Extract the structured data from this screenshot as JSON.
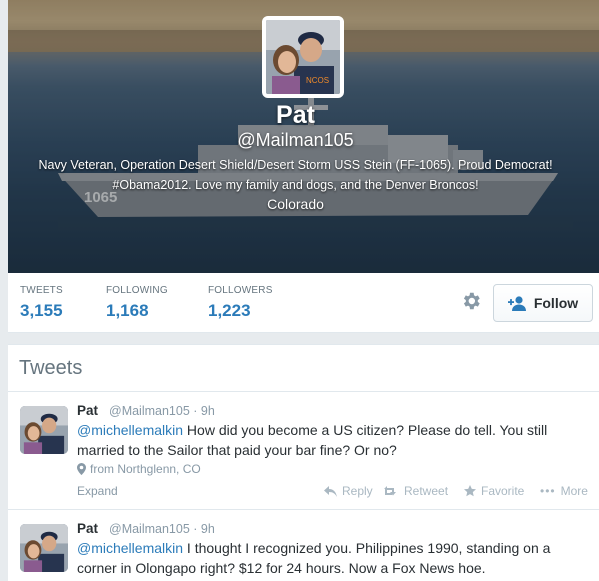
{
  "profile": {
    "name": "Pat",
    "handle": "@Mailman105",
    "bio_line1": "Navy Veteran, Operation Desert Shield/Desert Storm USS Stein (FF-1065). Proud Democrat!",
    "bio_line2": "#Obama2012. Love my family and dogs, and the Denver Broncos!",
    "location": "Colorado",
    "hull_number": "1065",
    "cap_text": "NCOS"
  },
  "stats": {
    "tweets_label": "TWEETS",
    "tweets_value": "3,155",
    "following_label": "FOLLOWING",
    "following_value": "1,168",
    "followers_label": "FOLLOWERS",
    "followers_value": "1,223",
    "follow_button": "Follow"
  },
  "timeline": {
    "title": "Tweets",
    "tweets": [
      {
        "name": "Pat",
        "handle": "@Mailman105",
        "time": "9h",
        "mention": "@michellemalkin",
        "text": " How did you become a US citizen? Please do tell. You still married to the Sailor that paid your bar fine? Or no?",
        "location": "from Northglenn, CO",
        "expand": "Expand",
        "reply": "Reply",
        "retweet": "Retweet",
        "favorite": "Favorite",
        "more": "More"
      },
      {
        "name": "Pat",
        "handle": "@Mailman105",
        "time": "9h",
        "mention": "@michellemalkin",
        "text": " I thought I recognized you. Philippines 1990, standing on a corner in Olongapo right? $12 for 24 hours. Now a Fox News hoe."
      }
    ]
  },
  "colors": {
    "accent": "#2b7bb9",
    "muted": "#8899a6",
    "background": "#e7ebee"
  },
  "icons": [
    "gear-icon",
    "add-user-icon",
    "location-pin-icon",
    "reply-icon",
    "retweet-icon",
    "favorite-icon",
    "more-icon"
  ]
}
